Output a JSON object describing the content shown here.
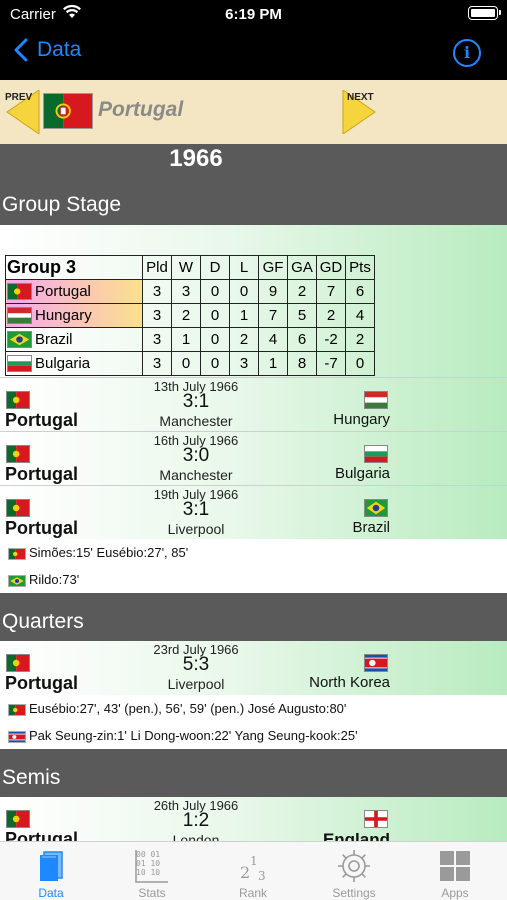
{
  "status_bar": {
    "carrier": "Carrier",
    "time": "6:19 PM"
  },
  "nav": {
    "back_label": "Data"
  },
  "team_header": {
    "prev_label": "PREV",
    "next_label": "NEXT",
    "team": "Portugal"
  },
  "year": "1966",
  "group_stage": {
    "title": "Group Stage",
    "table": {
      "group_name": "Group 3",
      "columns": [
        "Pld",
        "W",
        "D",
        "L",
        "GF",
        "GA",
        "GD",
        "Pts"
      ],
      "rows": [
        {
          "team": "Portugal",
          "flag": "portugal-flag",
          "values": [
            "3",
            "3",
            "0",
            "0",
            "9",
            "2",
            "7",
            "6"
          ]
        },
        {
          "team": "Hungary",
          "flag": "hungary-flag",
          "values": [
            "3",
            "2",
            "0",
            "1",
            "7",
            "5",
            "2",
            "4"
          ]
        },
        {
          "team": "Brazil",
          "flag": "brazil-flag",
          "values": [
            "3",
            "1",
            "0",
            "2",
            "4",
            "6",
            "-2",
            "2"
          ]
        },
        {
          "team": "Bulgaria",
          "flag": "bulgaria-flag",
          "values": [
            "3",
            "0",
            "0",
            "3",
            "1",
            "8",
            "-7",
            "0"
          ]
        }
      ]
    },
    "matches": [
      {
        "date": "13th July 1966",
        "score": "3:1",
        "venue": "Manchester",
        "home": "Portugal",
        "away": "Hungary"
      },
      {
        "date": "16th July 1966",
        "score": "3:0",
        "venue": "Manchester",
        "home": "Portugal",
        "away": "Bulgaria"
      },
      {
        "date": "19th July 1966",
        "score": "3:1",
        "venue": "Liverpool",
        "home": "Portugal",
        "away": "Brazil"
      }
    ],
    "scorers": [
      "Simões:15' Eusébio:27', 85'",
      "Rildo:73'"
    ]
  },
  "quarters": {
    "title": "Quarters",
    "match": {
      "date": "23rd July 1966",
      "score": "5:3",
      "venue": "Liverpool",
      "home": "Portugal",
      "away": "North Korea"
    },
    "scorers": [
      "Eusébio:27', 43' (pen.), 56', 59' (pen.) José Augusto:80'",
      "Pak Seung-zin:1' Li Dong-woon:22' Yang Seung-kook:25'"
    ]
  },
  "semis": {
    "title": "Semis",
    "match": {
      "date": "26th July 1966",
      "score": "1:2",
      "venue": "London",
      "home": "Portugal",
      "away": "England"
    }
  },
  "tabs": [
    {
      "label": "Data",
      "icon": "book-icon",
      "active": true
    },
    {
      "label": "Stats",
      "icon": "binary-stats-icon",
      "active": false
    },
    {
      "label": "Rank",
      "icon": "rank-numbers-icon",
      "active": false
    },
    {
      "label": "Settings",
      "icon": "gear-icon",
      "active": false
    },
    {
      "label": "Apps",
      "icon": "grid-icon",
      "active": false
    }
  ],
  "colors": {
    "accent": "#1e88ff",
    "section_bar": "#5a5a5a",
    "header_bg": "#f4e6c3"
  }
}
